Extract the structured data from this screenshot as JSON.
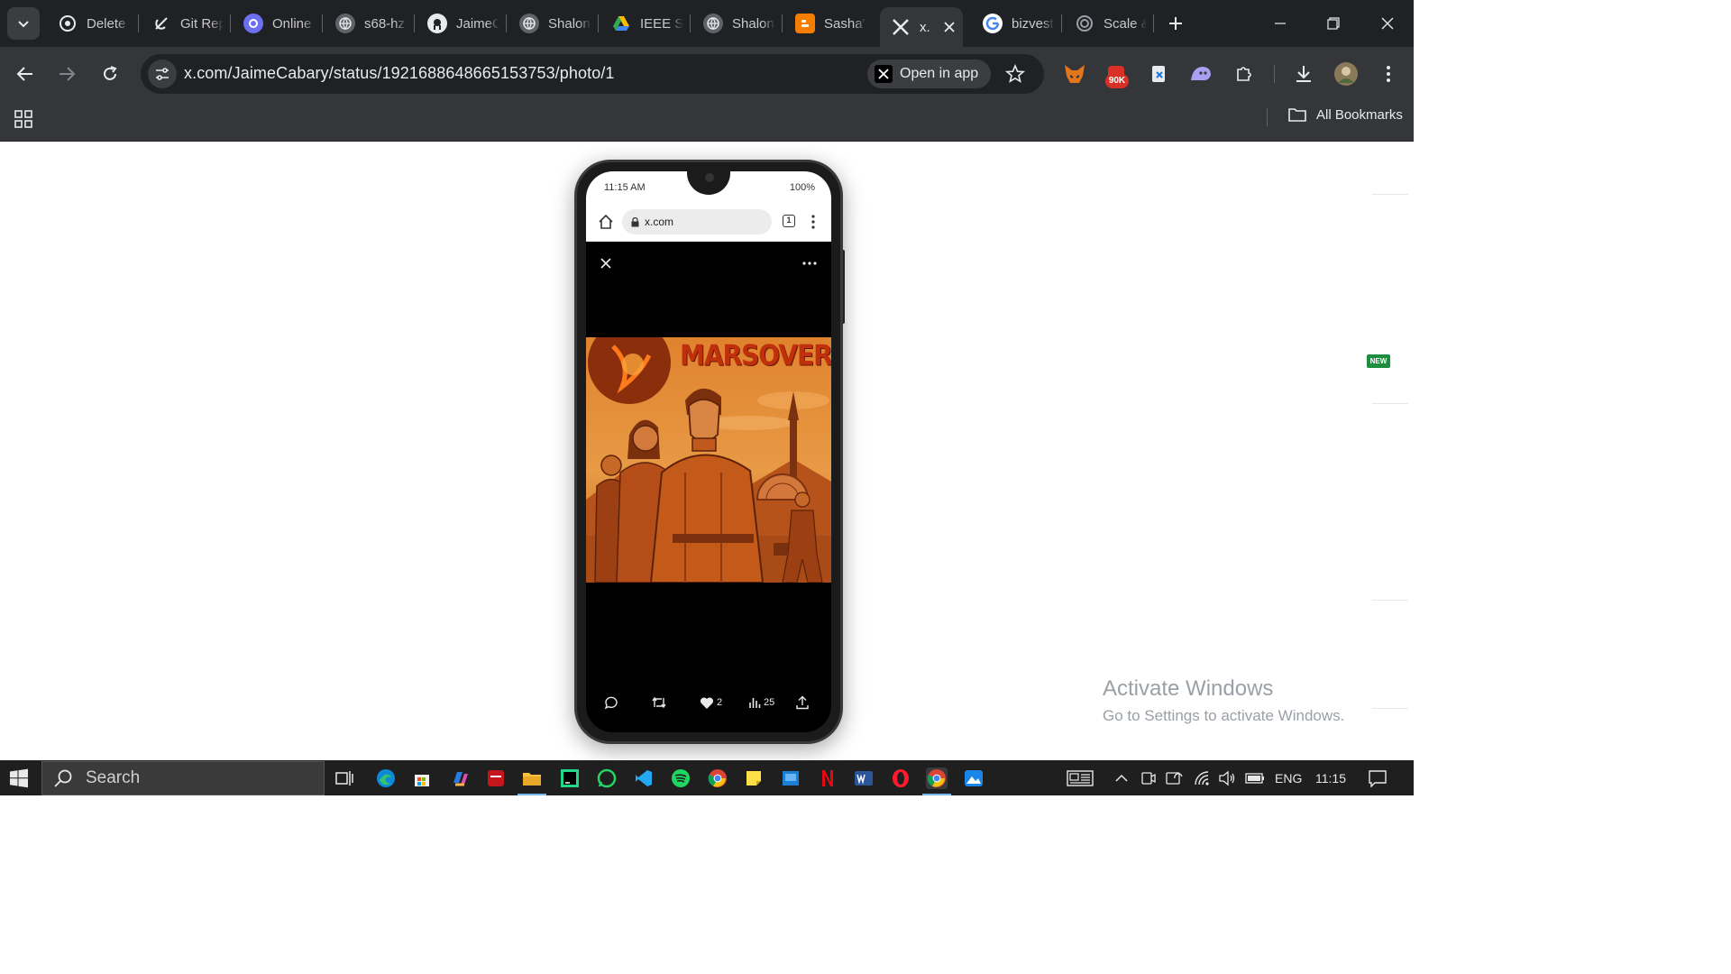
{
  "browser": {
    "tabs": [
      {
        "title": "Delete",
        "icon": "chatgpt-icon"
      },
      {
        "title": "Git Rep",
        "icon": "git-icon"
      },
      {
        "title": "Online",
        "icon": "online-icon"
      },
      {
        "title": "s68-hz",
        "icon": "globe-icon"
      },
      {
        "title": "JaimeC",
        "icon": "github-icon"
      },
      {
        "title": "Shalon",
        "icon": "globe-icon"
      },
      {
        "title": "IEEE SI",
        "icon": "google-drive-icon"
      },
      {
        "title": "Shalon",
        "icon": "globe-icon"
      },
      {
        "title": "Sasha'",
        "icon": "blogger-icon"
      },
      {
        "title": "x.",
        "icon": "x-icon",
        "active": true
      },
      {
        "title": "bizvest",
        "icon": "google-icon"
      },
      {
        "title": "Scale &",
        "icon": "scale-icon"
      }
    ],
    "url": "x.com/JaimeCabary/status/1921688648665153753/photo/1",
    "open_in_app": "Open in app",
    "extension_badge": "90K",
    "all_bookmarks": "All Bookmarks"
  },
  "phone": {
    "status_time": "11:15 AM",
    "status_battery": "100%",
    "mobile_url": "x.com",
    "tab_count": "1",
    "artwork_title": "MARSOVERSE",
    "actions": {
      "likes": "2",
      "views": "25"
    }
  },
  "watermark": {
    "title": "Activate Windows",
    "subtitle": "Go to Settings to activate Windows."
  },
  "side_badge": "NEW",
  "taskbar": {
    "search_label": "Search",
    "language": "ENG",
    "clock": "11:15"
  },
  "colors": {
    "chrome_dark": "#202124",
    "chrome_toolbar": "#35363a",
    "artwork_orange": "#d2691e",
    "artwork_title": "#c1300c",
    "taskbar": "#1f1f1f"
  }
}
